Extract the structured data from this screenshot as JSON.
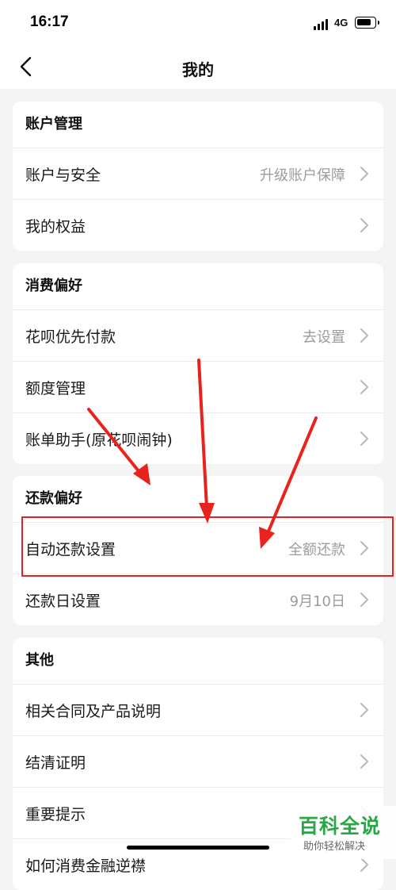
{
  "status_bar": {
    "time": "16:17",
    "network": "4G"
  },
  "nav": {
    "title": "我的",
    "back_icon": "chevron-left-icon"
  },
  "sections": [
    {
      "title": "账户管理",
      "rows": [
        {
          "label": "账户与安全",
          "value": "升级账户保障"
        },
        {
          "label": "我的权益",
          "value": ""
        }
      ]
    },
    {
      "title": "消费偏好",
      "rows": [
        {
          "label": "花呗优先付款",
          "value": "去设置"
        },
        {
          "label": "额度管理",
          "value": ""
        },
        {
          "label": "账单助手(原花呗闹钟)",
          "value": ""
        }
      ]
    },
    {
      "title": "还款偏好",
      "rows": [
        {
          "label": "自动还款设置",
          "value": "全额还款"
        },
        {
          "label": "还款日设置",
          "value": "9月10日"
        }
      ]
    },
    {
      "title": "其他",
      "rows": [
        {
          "label": "相关合同及产品说明",
          "value": ""
        },
        {
          "label": "结清证明",
          "value": ""
        },
        {
          "label": "重要提示",
          "value": ""
        },
        {
          "label": "如何消费金融逆襟",
          "value": ""
        }
      ]
    }
  ],
  "annotation": {
    "highlight_color": "#e02424"
  },
  "watermark": {
    "title": "百科全说",
    "subtitle": "助你轻松解决"
  }
}
